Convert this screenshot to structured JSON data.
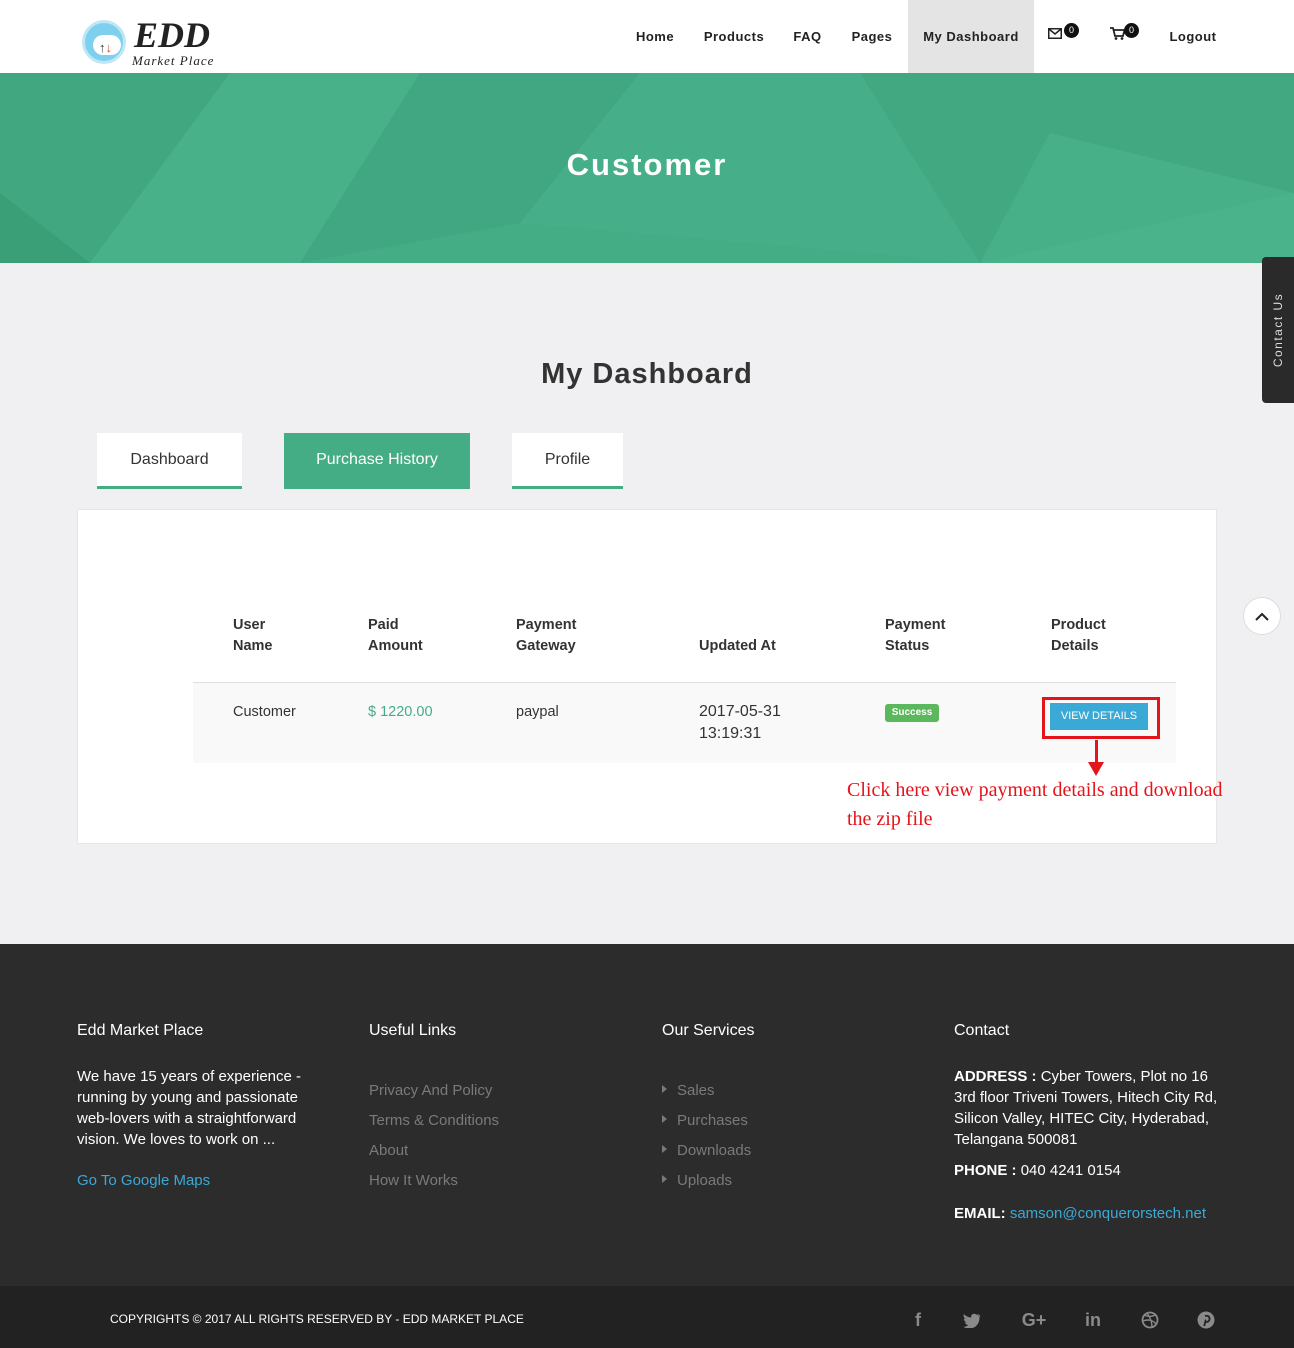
{
  "brand": {
    "title": "EDD",
    "subtitle": "Market Place"
  },
  "nav": {
    "home": "Home",
    "products": "Products",
    "faq": "FAQ",
    "pages": "Pages",
    "dashboard": "My Dashboard",
    "mail_count": "0",
    "cart_count": "0",
    "logout": "Logout"
  },
  "hero": {
    "title": "Customer"
  },
  "side": {
    "contact": "Contact Us"
  },
  "page": {
    "heading": "My Dashboard"
  },
  "tabs": {
    "dashboard": "Dashboard",
    "purchase_history": "Purchase History",
    "profile": "Profile"
  },
  "table": {
    "headers": {
      "user_name": [
        "User",
        "Name"
      ],
      "paid_amount": [
        "Paid",
        "Amount"
      ],
      "payment_gateway": [
        "Payment",
        "Gateway"
      ],
      "updated_at": "Updated At",
      "payment_status": [
        "Payment",
        "Status"
      ],
      "product_details": [
        "Product",
        "Details"
      ]
    },
    "row": {
      "user_name": "Customer",
      "paid_amount": "$ 1220.00",
      "gateway": "paypal",
      "updated_date": "2017-05-31",
      "updated_time": "13:19:31",
      "status": "Success",
      "action": "VIEW DETAILS"
    }
  },
  "annotation": "Click here view payment details and download the zip file",
  "footer": {
    "about": {
      "title": "Edd Market Place",
      "text": "We have 15 years of experience - running by young and passionate web-lovers with a straightforward vision. We loves to work on ...",
      "maps": "Go To Google Maps"
    },
    "links": {
      "title": "Useful Links",
      "items": [
        "Privacy And Policy",
        "Terms & Conditions",
        "About",
        "How It Works"
      ]
    },
    "services": {
      "title": "Our Services",
      "items": [
        "Sales",
        "Purchases",
        "Downloads",
        "Uploads"
      ]
    },
    "contact": {
      "title": "Contact",
      "address_label": "ADDRESS :",
      "address": "Cyber Towers, Plot no 16 3rd floor Triveni Towers, Hitech City Rd, Silicon Valley, HITEC City, Hyderabad, Telangana 500081",
      "phone_label": "PHONE :",
      "phone": "040 4241 0154",
      "email_label": "EMAIL:",
      "email": "samson@conquerorstech.net"
    },
    "copyright": "COPYRIGHTS © 2017 ALL RIGHTS RESERVED BY - EDD MARKET PLACE",
    "social": [
      "facebook-icon",
      "twitter-icon",
      "google-plus-icon",
      "linkedin-icon",
      "dribbble-icon",
      "pinterest-icon"
    ]
  },
  "colors": {
    "accent": "#44ad86",
    "link": "#3aa9d6",
    "highlight": "#e4141b",
    "footer": "#2c2c2c"
  }
}
